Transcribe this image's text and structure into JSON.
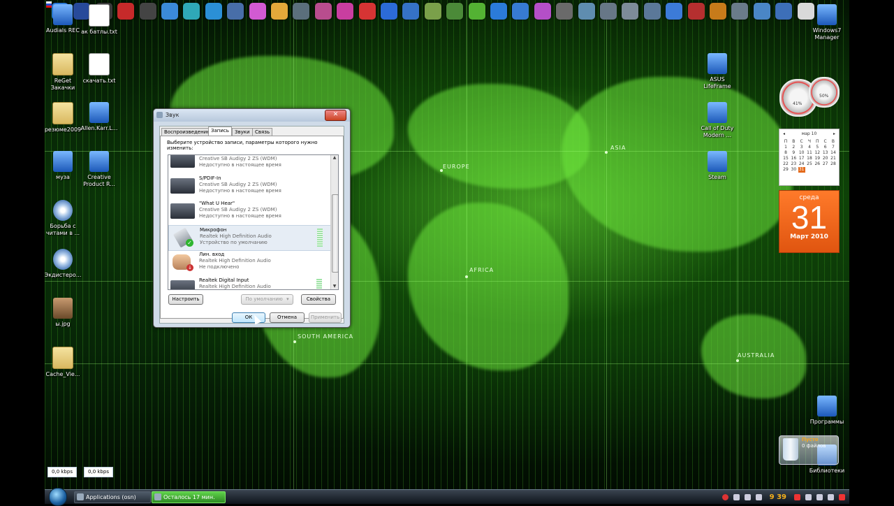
{
  "top_icons": [
    {
      "name": "flag-ru-icon",
      "color": "#ffffff"
    },
    {
      "name": "ie-icon",
      "color": "#2a78d4"
    },
    {
      "name": "media-player-icon",
      "color": "#274a9a"
    },
    {
      "name": "circle-icon",
      "color": "#3b3b3b"
    },
    {
      "name": "opera-icon",
      "color": "#c62a2a"
    },
    {
      "name": "film-icon",
      "color": "#444444"
    },
    {
      "name": "puzzle-icon",
      "color": "#3b8ad9"
    },
    {
      "name": "settings-icon",
      "color": "#2fa8b8"
    },
    {
      "name": "skype-icon",
      "color": "#2b90d6"
    },
    {
      "name": "pen-icon",
      "color": "#486ea8"
    },
    {
      "name": "color-wheel-icon",
      "color": "#d25ad2"
    },
    {
      "name": "r-icon",
      "color": "#e3a83a"
    },
    {
      "name": "reload-icon",
      "color": "#5b6f7c"
    },
    {
      "name": "paint-icon",
      "color": "#b84d8e"
    },
    {
      "name": "check-icon",
      "color": "#c93ea0"
    },
    {
      "name": "stop-icon",
      "color": "#d63434"
    },
    {
      "name": "v-icon",
      "color": "#2c6bd8"
    },
    {
      "name": "s-icon",
      "color": "#3572c6"
    },
    {
      "name": "tool-icon",
      "color": "#7aa04a"
    },
    {
      "name": "dots-icon",
      "color": "#4b8a38"
    },
    {
      "name": "flower-icon",
      "color": "#53b233"
    },
    {
      "name": "at-icon",
      "color": "#2b7bd9"
    },
    {
      "name": "chart-icon",
      "color": "#377bd2"
    },
    {
      "name": "tag-icon",
      "color": "#b44fc8"
    },
    {
      "name": "scissors-icon",
      "color": "#6a6a6a"
    },
    {
      "name": "image-icon",
      "color": "#5f8db0"
    },
    {
      "name": "window-icon",
      "color": "#677787"
    },
    {
      "name": "drive-icon",
      "color": "#7d8b99"
    },
    {
      "name": "grid-icon",
      "color": "#5b7899"
    },
    {
      "name": "r2-icon",
      "color": "#3c7bd8"
    },
    {
      "name": "v2-icon",
      "color": "#b52f2f"
    },
    {
      "name": "two-icon",
      "color": "#c77b1a"
    },
    {
      "name": "key-icon",
      "color": "#6a7c8a"
    },
    {
      "name": "scan-icon",
      "color": "#4a86c6"
    },
    {
      "name": "search-icon",
      "color": "#3d6fb8"
    },
    {
      "name": "face-icon",
      "color": "#d9d9d9"
    }
  ],
  "desktop_icons": [
    {
      "label": "Audials REC",
      "type": "app"
    },
    {
      "label": "ак батлы.txt",
      "type": "txt"
    },
    {
      "label": "ReGet\nЗакачки",
      "type": "folder"
    },
    {
      "label": "скачать.txt",
      "type": "txt"
    },
    {
      "label": "резюме2009",
      "type": "folder"
    },
    {
      "label": "Allen.Karr.L...",
      "type": "app"
    },
    {
      "label": "муза",
      "type": "app"
    },
    {
      "label": "Creative\nProduct R...",
      "type": "app"
    },
    {
      "label": "Борьба с\nчитами в ...",
      "type": "cd"
    },
    {
      "label": "Экдистеро...",
      "type": "cd"
    },
    {
      "label": "ы.jpg",
      "type": "photo"
    },
    {
      "label": "Cache_Vie...",
      "type": "folder"
    },
    {
      "label": "Windows7\nManager",
      "type": "app"
    },
    {
      "label": "ASUS\nLifeFrame",
      "type": "app"
    },
    {
      "label": "Call of Duty\nModern ...",
      "type": "app"
    },
    {
      "label": "Steam",
      "type": "app"
    },
    {
      "label": "Программы",
      "type": "app"
    },
    {
      "label": "Библиотеки",
      "type": "app"
    }
  ],
  "map_labels": {
    "europe": "EUROPE",
    "asia": "ASIA",
    "africa": "AFRICA",
    "south_america": "SOUTH AMERICA",
    "australia": "AUSTRALIA"
  },
  "dialog": {
    "title": "Звук",
    "close_label": "✕",
    "tabs": [
      "Воспроизведение",
      "Запись",
      "Звуки",
      "Связь"
    ],
    "active_tab": "Запись",
    "instruction": "Выберите устройство записи, параметры которого нужно изменить:",
    "devices": [
      {
        "name": "",
        "driver": "Creative SB Audigy 2 ZS (WDM)",
        "status": "Недоступно в настоящее время",
        "selected": false
      },
      {
        "name": "S/PDIF-In",
        "driver": "Creative SB Audigy 2 ZS (WDM)",
        "status": "Недоступно в настоящее время",
        "selected": false
      },
      {
        "name": "\"What U Hear\"",
        "driver": "Creative SB Audigy 2 ZS (WDM)",
        "status": "Недоступно в настоящее время",
        "selected": false
      },
      {
        "name": "Микрофон",
        "driver": "Realtek High Definition Audio",
        "status": "Устройство по умолчанию",
        "selected": true
      },
      {
        "name": "Лин. вход",
        "driver": "Realtek High Definition Audio",
        "status": "Не подключено",
        "selected": false
      },
      {
        "name": "Realtek Digital Input",
        "driver": "Realtek High Definition Audio",
        "status": "",
        "selected": false
      }
    ],
    "buttons": {
      "configure": "Настроить",
      "default": "По умолчанию",
      "properties": "Свойства",
      "ok": "ОК",
      "cancel": "Отмена",
      "apply": "Применить"
    }
  },
  "calendar": {
    "header": "мар 10",
    "weekdays": [
      "П",
      "В",
      "С",
      "Ч",
      "П",
      "С",
      "В"
    ],
    "weeks": [
      [
        "1",
        "2",
        "3",
        "4",
        "5",
        "6",
        "7"
      ],
      [
        "8",
        "9",
        "10",
        "11",
        "12",
        "13",
        "14"
      ],
      [
        "15",
        "16",
        "17",
        "18",
        "19",
        "20",
        "21"
      ],
      [
        "22",
        "23",
        "24",
        "25",
        "26",
        "27",
        "28"
      ],
      [
        "29",
        "30",
        "31",
        "",
        "",
        "",
        ""
      ]
    ],
    "today": "31",
    "weekday_name": "среда",
    "day": "31",
    "month_year": "Март 2010"
  },
  "meters": {
    "cpu": "41%",
    "mem": "50%"
  },
  "recycle_bin": {
    "state": "Пусто",
    "count": "0 файлов"
  },
  "speed_boxes": [
    "0,0 kbps",
    "0,0 kbps"
  ],
  "taskbar": {
    "buttons": [
      "Applications (osn)",
      "Осталось 17 мин."
    ],
    "clock": "9 39",
    "accent": "#f6b11c"
  }
}
